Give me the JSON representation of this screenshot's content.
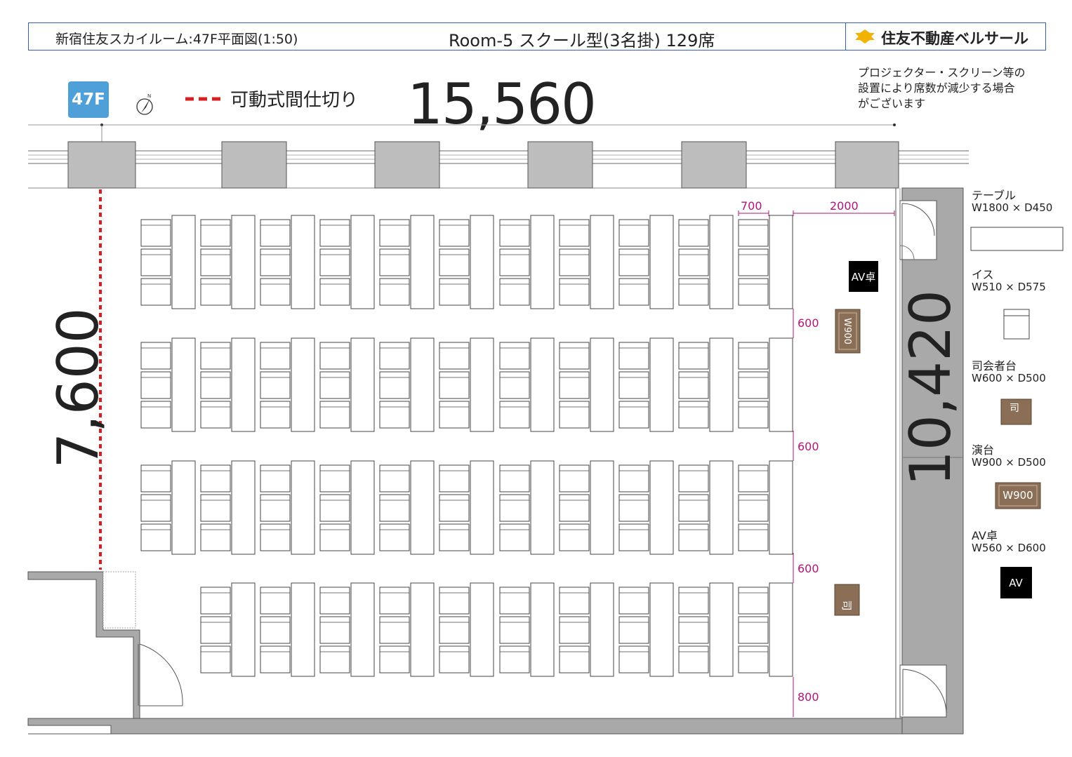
{
  "header": {
    "left_title": "新宿住友スカイルーム:47F平面図(1:50)",
    "center_title": "Room-5 スクール型(3名掛) 129席",
    "logo_text": "住友不動産ベルサール",
    "colors": {
      "border": "#3a5fa8",
      "logo_icon": "#f0b400"
    }
  },
  "floor_badge": {
    "label": "47F",
    "color": "#4f9fd8"
  },
  "north_icon": "compass-north-icon",
  "partition_legend": {
    "label": "可動式間仕切り",
    "color": "#d42020"
  },
  "dimensions": {
    "width": "15,560",
    "depth_left": "7,600",
    "depth_right": "10,420",
    "col_gap": "700",
    "front_space": "2000",
    "row_gaps": [
      "600",
      "600",
      "600"
    ],
    "rear_space": "800",
    "dim_color": "#b0157a"
  },
  "note": {
    "lines": [
      "プロジェクター・スクリーン等の",
      "設置により席数が減少する場合",
      "がございます"
    ]
  },
  "stage": {
    "av_label": "AV卓",
    "lectern_label": "W900",
    "mc_label": "司"
  },
  "layout": {
    "columns_per_row": [
      11,
      11,
      11,
      10
    ],
    "seats_per_table": 3,
    "total_seats": 129
  },
  "legend": {
    "table": {
      "label": "テーブル",
      "size": "W1800 × D450"
    },
    "chair": {
      "label": "イス",
      "size": "W510 × D575"
    },
    "mc": {
      "label": "司会者台",
      "size": "W600 × D500",
      "glyph": "司"
    },
    "lectern": {
      "label": "演台",
      "size": "W900 × D500",
      "glyph": "W900"
    },
    "av": {
      "label": "AV卓",
      "size": "W560 × D600",
      "glyph": "AV"
    }
  },
  "colors": {
    "wall": "#a9a9a9",
    "lectern": "#8a6e55",
    "av": "#000000"
  }
}
